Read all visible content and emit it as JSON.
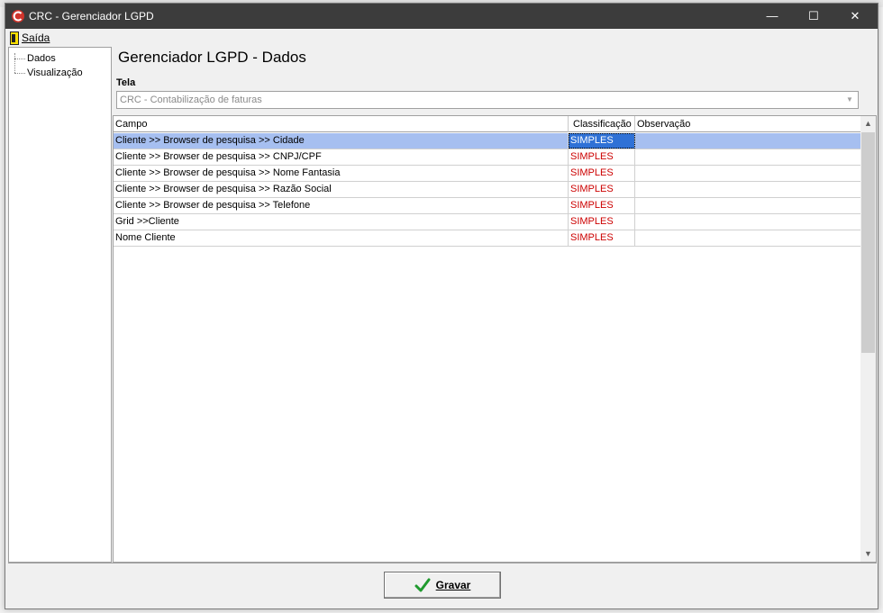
{
  "window": {
    "title": "CRC - Gerenciador LGPD",
    "minimize": "—",
    "maximize": "☐",
    "close": "✕"
  },
  "menu": {
    "exit_label": "Saída"
  },
  "sidebar": {
    "items": [
      {
        "label": "Dados"
      },
      {
        "label": "Visualização"
      }
    ]
  },
  "main": {
    "title": "Gerenciador LGPD - Dados",
    "tela_label": "Tela",
    "tela_value": "CRC - Contabilização de faturas",
    "columns": [
      "Campo",
      "Classificação",
      "Observação"
    ],
    "rows": [
      {
        "campo": "Cliente >> Browser de pesquisa >> Cidade",
        "classificacao": "SIMPLES",
        "observacao": ""
      },
      {
        "campo": "Cliente >> Browser de pesquisa >> CNPJ/CPF",
        "classificacao": "SIMPLES",
        "observacao": ""
      },
      {
        "campo": "Cliente >> Browser de pesquisa >> Nome Fantasia",
        "classificacao": "SIMPLES",
        "observacao": ""
      },
      {
        "campo": "Cliente >> Browser de pesquisa >> Razão Social",
        "classificacao": "SIMPLES",
        "observacao": ""
      },
      {
        "campo": "Cliente >> Browser de pesquisa >> Telefone",
        "classificacao": "SIMPLES",
        "observacao": ""
      },
      {
        "campo": "Grid >>Cliente",
        "classificacao": "SIMPLES",
        "observacao": ""
      },
      {
        "campo": "Nome Cliente",
        "classificacao": "SIMPLES",
        "observacao": ""
      }
    ]
  },
  "footer": {
    "save_label": "Gravar"
  },
  "icons": {
    "app": "crc-logo-icon",
    "exit": "door-exit-icon",
    "save": "checkmark-icon",
    "dropdown": "chevron-down-icon"
  },
  "colors": {
    "titlebar": "#3c3c3c",
    "selected_row": "#a6bff0",
    "selected_cell": "#2f71d6",
    "classification_text": "#cc0000",
    "check_green": "#1f9a2e"
  }
}
